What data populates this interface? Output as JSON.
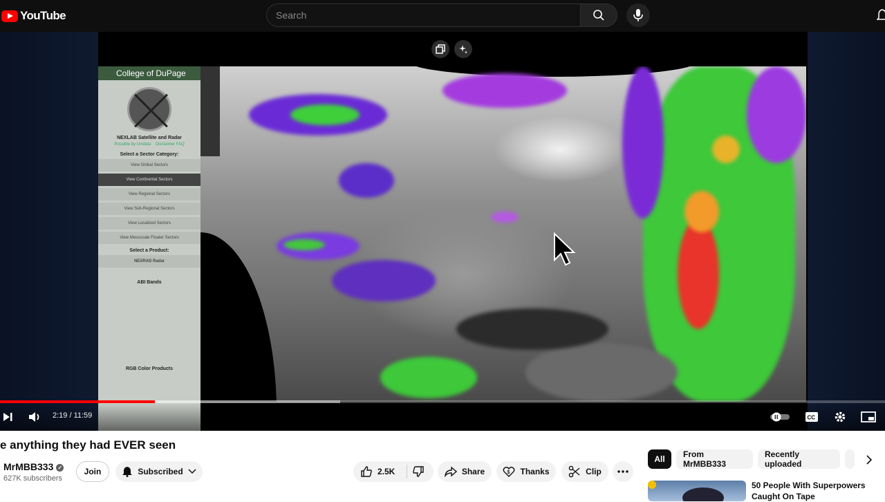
{
  "header": {
    "logo_text": "YouTube",
    "search_placeholder": "Search"
  },
  "player": {
    "panel": {
      "brand": "College of DuPage",
      "title": "NEXLAB Satellite and Radar",
      "links": [
        "Possible by Unidata",
        "Disclaimer FAQ"
      ],
      "select_sector": "Select a Sector Category:",
      "sectors": [
        "View Global Sectors",
        "View Continental Sectors",
        "View Regional Sectors",
        "View Sub-Regional Sectors",
        "View Localized Sectors",
        "View Mesoscale Floater Sectors"
      ],
      "select_product": "Select a Product:",
      "nexrad": "NEXRAD Radar",
      "abi": "ABI Bands",
      "rgb": "RGB Color Products"
    },
    "time_display": "2:19 / 11:59",
    "progress_fraction": 0.175,
    "buffered_fraction": 0.384
  },
  "video": {
    "title": "e anything they had EVER seen",
    "channel": "MrMBB333",
    "subscribers": "627K subscribers",
    "join_label": "Join",
    "subscribed_label": "Subscribed",
    "likes": "2.5K",
    "share_label": "Share",
    "thanks_label": "Thanks",
    "clip_label": "Clip"
  },
  "sidebar": {
    "chips": [
      "All",
      "From MrMBB333",
      "Recently uploaded"
    ],
    "rec_title": "50 People With Superpowers Caught On Tape"
  },
  "colors": {
    "accent": "#ff0000",
    "dark": "#0f0f0f"
  }
}
